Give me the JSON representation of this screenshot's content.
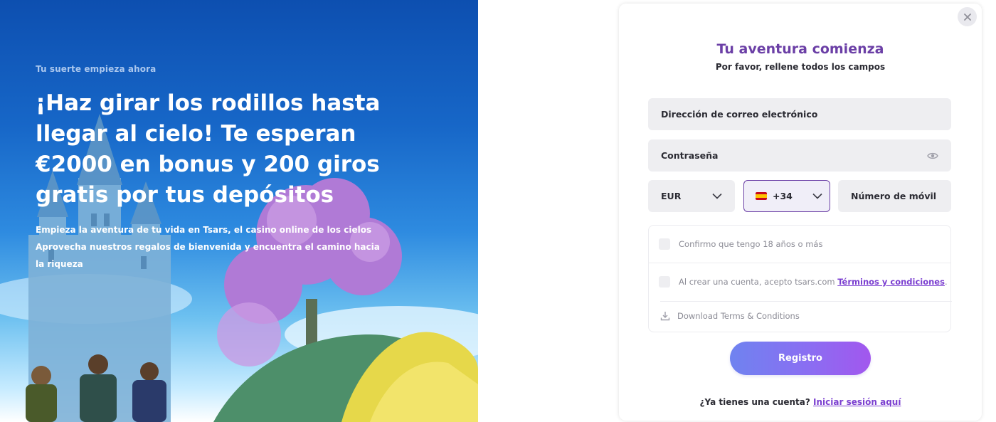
{
  "hero": {
    "kicker": "Tu suerte empieza ahora",
    "title": "¡Haz girar los rodillos hasta llegar al cielo! Te esperan €2000 en bonus y 200 giros gratis por tus depósitos",
    "desc_line1": "Empieza la aventura de tu vida en Tsars, el casino online de los cielos",
    "desc_line2": "Aprovecha nuestros regalos de bienvenida y encuentra el camino hacia la riqueza"
  },
  "modal": {
    "title": "Tu aventura comienza",
    "subtitle": "Por favor, rellene todos los campos",
    "close_icon": "close-icon",
    "fields": {
      "email_placeholder": "Dirección de correo electrónico",
      "password_placeholder": "Contraseña",
      "currency_value": "EUR",
      "phone_code": "+34",
      "phone_flag": "spain-flag-icon",
      "mobile_placeholder": "Número de móvil"
    },
    "consents": {
      "age_label": "Confirmo que tengo 18 años o más",
      "terms_prefix": "Al crear una cuenta, acepto tsars.com",
      "terms_link": "Términos y condiciones",
      "terms_suffix": ".",
      "download_label": "Download Terms & Conditions"
    },
    "register_button": "Registro",
    "login_prompt": "¿Ya tienes una cuenta?",
    "login_link": "Iniciar sesión aquí"
  },
  "colors": {
    "accent_purple": "#6b3fa6",
    "link_purple": "#7b3fd0",
    "button_gradient_start": "#6f83f0",
    "button_gradient_end": "#a257ee",
    "field_bg": "#eeeef1"
  }
}
